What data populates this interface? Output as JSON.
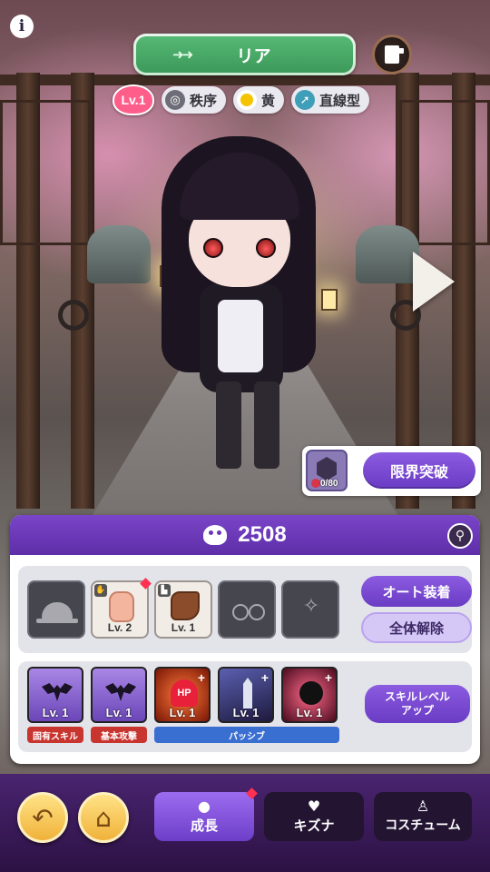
{
  "header": {
    "info_icon": "info-icon",
    "character_name": "リア",
    "swap_icon": "swap-arrows-icon",
    "profile_icon": "document-icon"
  },
  "tags": {
    "level": "Lv.1",
    "items": [
      {
        "icon": "order-icon",
        "label": "秩序"
      },
      {
        "icon": "yellow-dot-icon",
        "label": "黄"
      },
      {
        "icon": "linear-type-icon",
        "label": "直線型"
      }
    ]
  },
  "navigation": {
    "next_icon": "next-arrow-icon"
  },
  "limit_break": {
    "shard_count": "0/80",
    "button_label": "限界突破"
  },
  "panel": {
    "power_icon": "power-icon",
    "power_value": "2508",
    "search_icon": "magnifier-icon",
    "equipment": [
      {
        "slot": "head",
        "icon": "hat-icon",
        "level": ""
      },
      {
        "slot": "hands",
        "icon": "glove-icon",
        "level": "Lv. 2"
      },
      {
        "slot": "feet",
        "icon": "boot-icon",
        "level": "Lv. 1"
      },
      {
        "slot": "accessory",
        "icon": "glasses-icon",
        "level": ""
      },
      {
        "slot": "special",
        "icon": "accessory-icon",
        "level": ""
      }
    ],
    "auto_equip_label": "オート装着",
    "release_all_label": "全体解除",
    "skills": [
      {
        "icon": "bat-icon",
        "level": "Lv. 1"
      },
      {
        "icon": "bat-icon",
        "level": "Lv. 1"
      },
      {
        "icon": "hp-heart-icon",
        "level": "Lv. 1",
        "icon_text": "HP"
      },
      {
        "icon": "sword-icon",
        "level": "Lv. 1"
      },
      {
        "icon": "skull-icon",
        "level": "Lv. 1"
      }
    ],
    "skill_labels": {
      "unique": "固有スキル",
      "basic": "基本攻撃",
      "passive": "パッシブ"
    },
    "skill_level_up_line1": "スキルレベル",
    "skill_level_up_line2": "アップ"
  },
  "bottom_nav": {
    "back_icon": "back-arrow-icon",
    "home_icon": "home-icon",
    "tabs": [
      {
        "label": "成長",
        "icon": "growth-icon"
      },
      {
        "label": "キズナ",
        "icon": "hearts-icon"
      },
      {
        "label": "コスチューム",
        "icon": "dress-icon"
      }
    ]
  },
  "colors": {
    "accent_purple": "#6a3cc4",
    "name_green": "#4cae6a",
    "level_pink": "#ff5d8a",
    "notification_red": "#ff3050"
  }
}
